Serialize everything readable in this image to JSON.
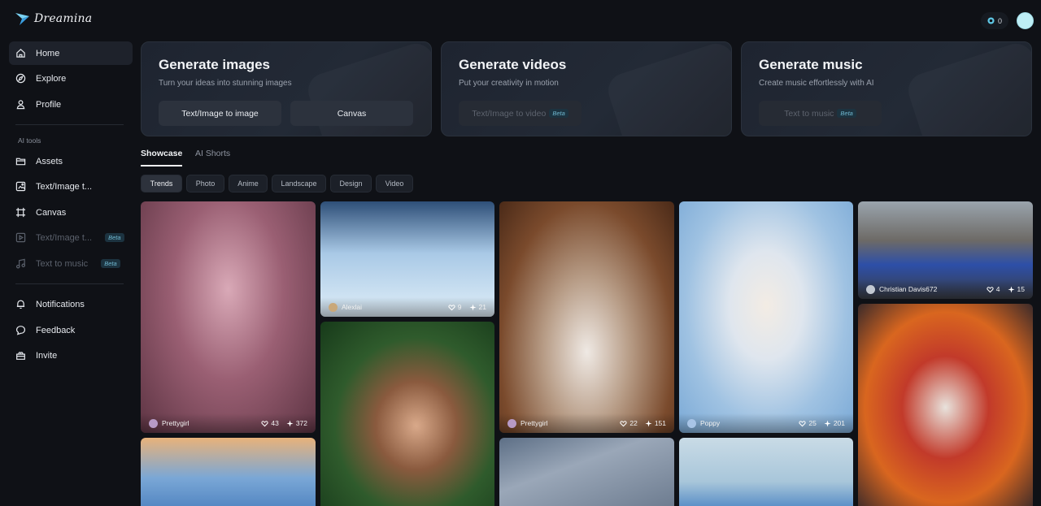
{
  "app": {
    "name": "Dreamina"
  },
  "sidebar": {
    "main": [
      {
        "label": "Home",
        "icon": "home-icon",
        "active": true
      },
      {
        "label": "Explore",
        "icon": "compass-icon"
      },
      {
        "label": "Profile",
        "icon": "user-icon"
      }
    ],
    "tools_label": "AI tools",
    "tools": [
      {
        "label": "Assets",
        "icon": "folder-icon"
      },
      {
        "label": "Text/Image t...",
        "icon": "image-icon"
      },
      {
        "label": "Canvas",
        "icon": "canvas-icon"
      },
      {
        "label": "Text/Image t...",
        "icon": "video-icon",
        "badge": "Beta",
        "disabled": true
      },
      {
        "label": "Text to music",
        "icon": "music-icon",
        "badge": "Beta",
        "disabled": true
      }
    ],
    "footer": [
      {
        "label": "Notifications",
        "icon": "bell-icon"
      },
      {
        "label": "Feedback",
        "icon": "chat-icon"
      },
      {
        "label": "Invite",
        "icon": "gift-icon"
      }
    ]
  },
  "header": {
    "credits": "0"
  },
  "generate": {
    "images": {
      "title": "Generate images",
      "subtitle": "Turn your ideas into stunning images",
      "btn1": "Text/Image to image",
      "btn2": "Canvas"
    },
    "videos": {
      "title": "Generate videos",
      "subtitle": "Put your creativity in motion",
      "btn1": "Text/Image to video",
      "badge": "Beta"
    },
    "music": {
      "title": "Generate music",
      "subtitle": "Create music effortlessly with AI",
      "btn1": "Text to music",
      "badge": "Beta"
    }
  },
  "tabs": [
    "Showcase",
    "AI Shorts"
  ],
  "filters": [
    "Trends",
    "Photo",
    "Anime",
    "Landscape",
    "Design",
    "Video"
  ],
  "gallery": [
    {
      "author": "Prettygirl",
      "likes": "43",
      "remixes": "372"
    },
    {
      "author": "Alexlai",
      "likes": "9",
      "remixes": "21"
    },
    {
      "author": "Prettygirl",
      "likes": "22",
      "remixes": "151"
    },
    {
      "author": "Poppy",
      "likes": "25",
      "remixes": "201"
    },
    {
      "author": "Christian Davis672",
      "likes": "4",
      "remixes": "15"
    }
  ],
  "colors": {
    "background": "#0f1116",
    "accent": "#6fb7cf",
    "card": "#1e2430"
  }
}
